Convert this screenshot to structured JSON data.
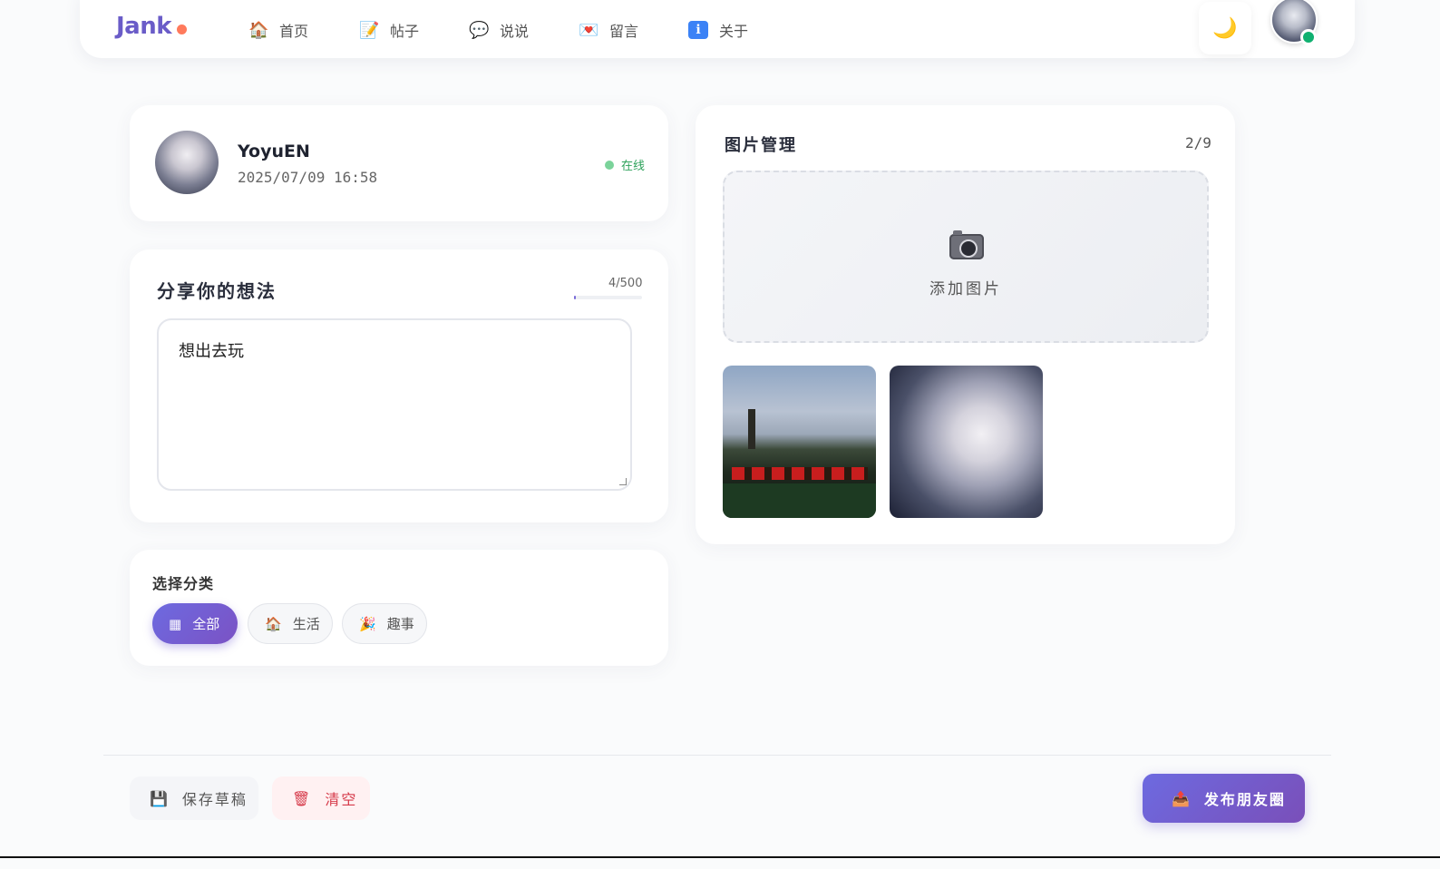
{
  "nav": {
    "logo": "Jank",
    "items": [
      {
        "label": "首页",
        "icon": "house-icon",
        "glyph": "🏠"
      },
      {
        "label": "帖子",
        "icon": "pencil-icon",
        "glyph": "📝"
      },
      {
        "label": "说说",
        "icon": "speech-bubble-icon",
        "glyph": "💬"
      },
      {
        "label": "留言",
        "icon": "love-letter-icon",
        "glyph": "💌"
      },
      {
        "label": "关于",
        "icon": "info-icon",
        "glyph": "ℹ"
      }
    ],
    "theme_icon": "moon-icon",
    "theme_glyph": "🌙"
  },
  "user": {
    "name": "YoyuEN",
    "time": "2025/07/09 16:58",
    "status": "在线",
    "status_color": "#2ea25b"
  },
  "thought": {
    "title": "分享你的想法",
    "count": "4/500",
    "progress": 0.008,
    "content": "想出去玩"
  },
  "category": {
    "title": "选择分类",
    "chips": [
      {
        "label": "全部",
        "glyph": "▦",
        "icon": "grid-icon",
        "active": true
      },
      {
        "label": "生活",
        "glyph": "🏠",
        "icon": "house-icon",
        "active": false
      },
      {
        "label": "趣事",
        "glyph": "🎉",
        "icon": "party-popper-icon",
        "active": false
      }
    ]
  },
  "images": {
    "title": "图片管理",
    "count": "2/9",
    "upload_label": "添加图片"
  },
  "actions": {
    "save_label": "保存草稿",
    "save_glyph": "💾",
    "clear_label": "清空",
    "clear_glyph": "🗑",
    "publish_label": "发布朋友圈",
    "publish_glyph": "📤"
  },
  "colors": {
    "accent": "#6d6ae0",
    "online": "#10b070",
    "danger": "#d63a4a"
  }
}
